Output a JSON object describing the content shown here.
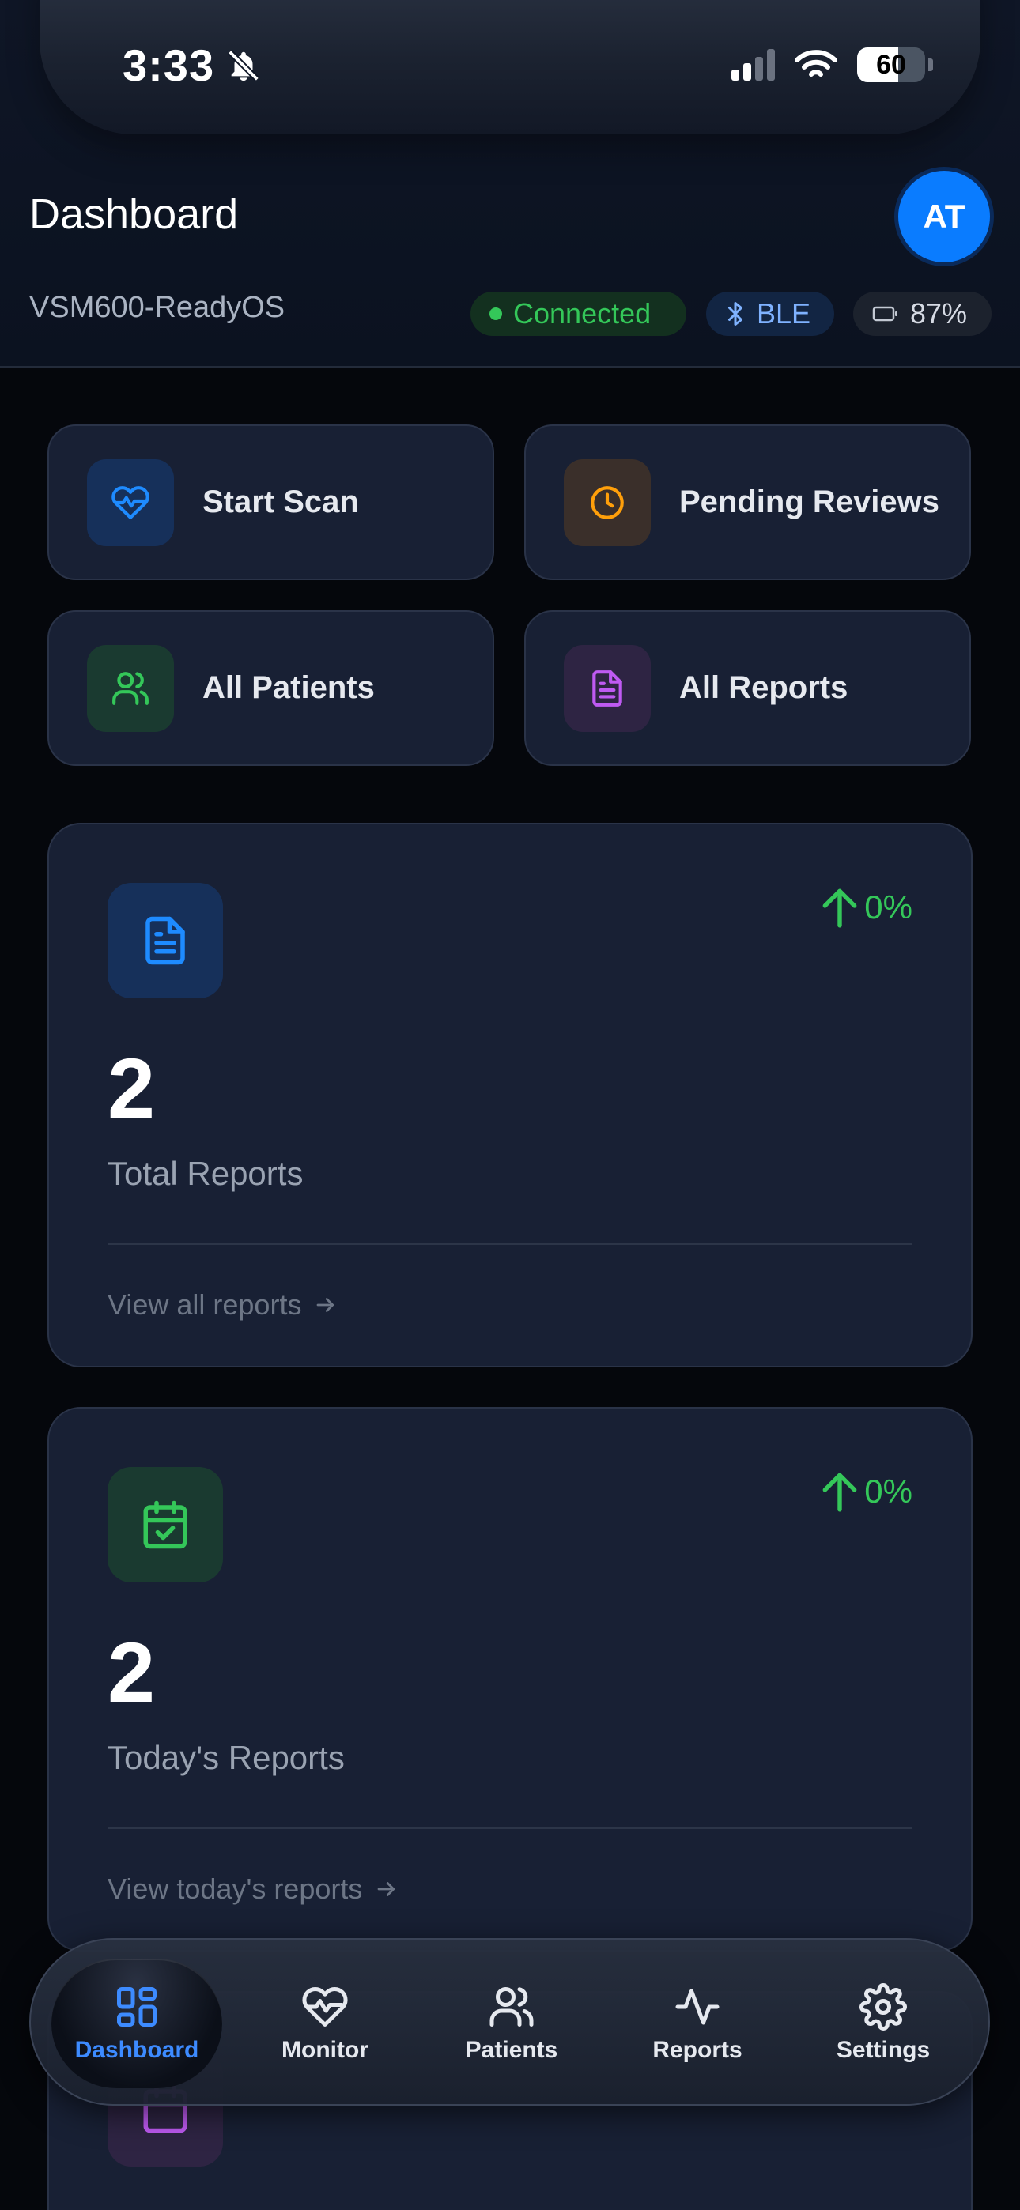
{
  "status_bar": {
    "time": "3:33",
    "battery_level": "60",
    "battery_fraction": 0.6
  },
  "header": {
    "title": "Dashboard",
    "device_name": "VSM600-ReadyOS",
    "avatar_initials": "AT",
    "connection_status": "Connected",
    "connection_type": "BLE",
    "device_battery": "87%"
  },
  "quick_actions": [
    {
      "label": "Start Scan",
      "icon": "heart-pulse-icon",
      "color": "#1e8bff"
    },
    {
      "label": "Pending Reviews",
      "icon": "clock-icon",
      "color": "#ff9f0a"
    },
    {
      "label": "All Patients",
      "icon": "users-icon",
      "color": "#34c759"
    },
    {
      "label": "All Reports",
      "icon": "document-icon",
      "color": "#bf5af2"
    }
  ],
  "stats": [
    {
      "value": "2",
      "label": "Total Reports",
      "trend": "0%",
      "link": "View all reports",
      "icon": "document-icon",
      "color": "#1e8bff"
    },
    {
      "value": "2",
      "label": "Today's Reports",
      "trend": "0%",
      "link": "View today's reports",
      "icon": "calendar-check-icon",
      "color": "#34c759"
    }
  ],
  "bottom_nav": {
    "active": "Dashboard",
    "items": [
      {
        "label": "Dashboard",
        "icon": "dashboard-grid-icon"
      },
      {
        "label": "Monitor",
        "icon": "heart-pulse-icon"
      },
      {
        "label": "Patients",
        "icon": "users-icon"
      },
      {
        "label": "Reports",
        "icon": "activity-icon"
      },
      {
        "label": "Settings",
        "icon": "gear-icon"
      }
    ]
  },
  "colors": {
    "accent": "#0a7cff",
    "success": "#34c759",
    "background": "#05070c",
    "card": "#182034"
  }
}
